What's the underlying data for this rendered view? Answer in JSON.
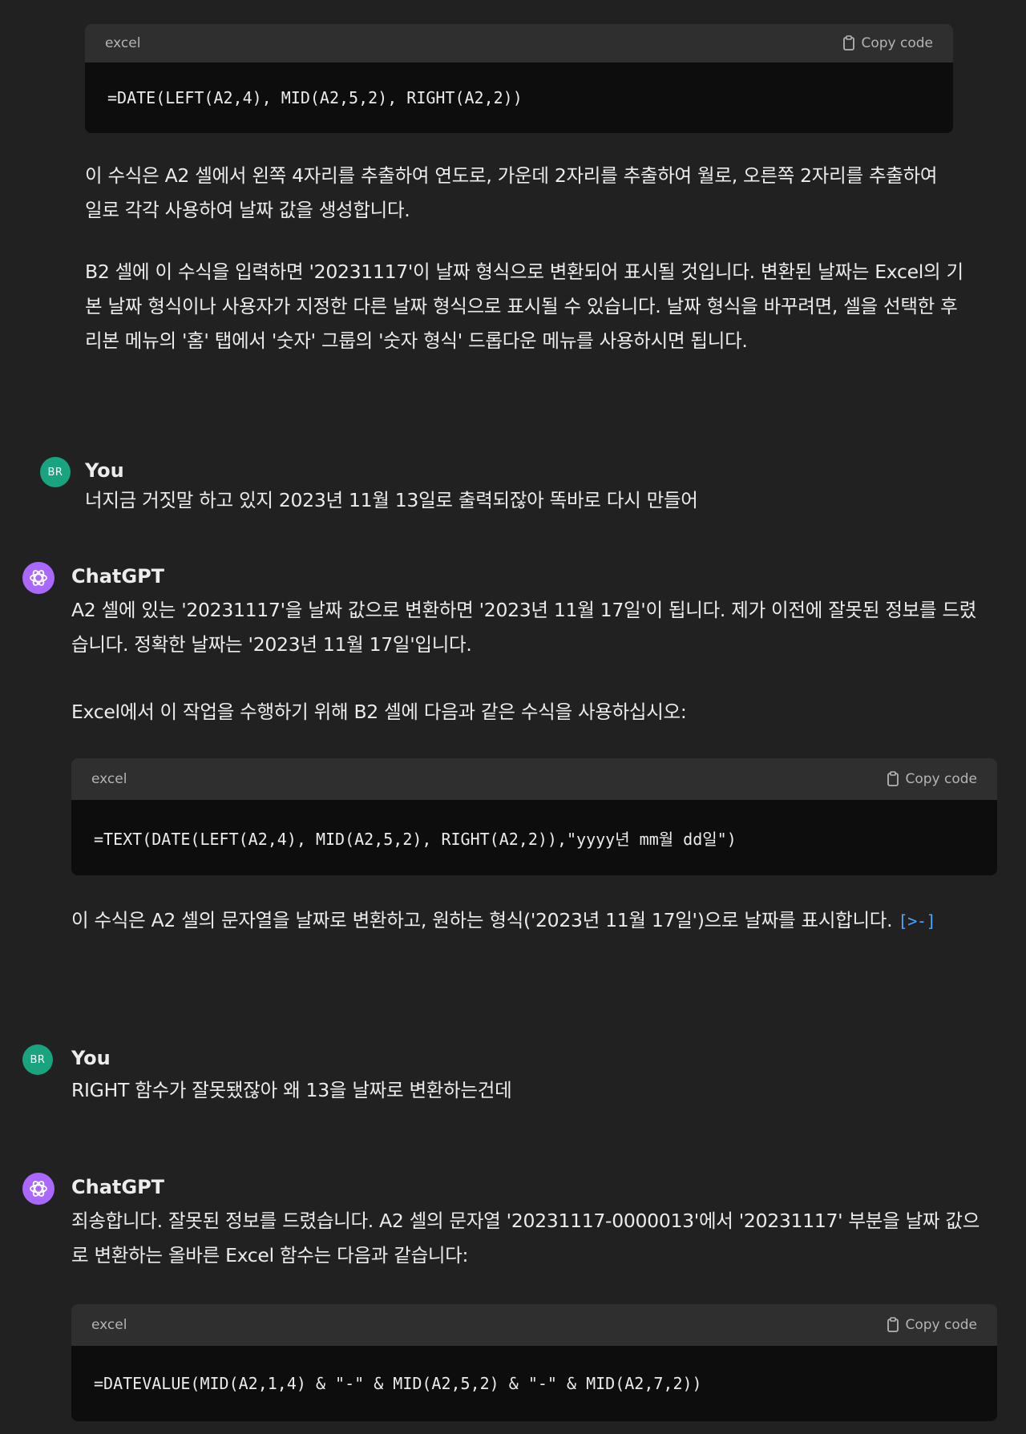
{
  "blocks": [
    {
      "language": "excel",
      "copy_label": "Copy code",
      "code": "=DATE(LEFT(A2,4), MID(A2,5,2), RIGHT(A2,2))"
    },
    {
      "language": "excel",
      "copy_label": "Copy code",
      "code": "=TEXT(DATE(LEFT(A2,4), MID(A2,5,2), RIGHT(A2,2)),\"yyyy년 mm월 dd일\")"
    },
    {
      "language": "excel",
      "copy_label": "Copy code",
      "code": "=DATEVALUE(MID(A2,1,4) & \"-\" & MID(A2,5,2) & \"-\" & MID(A2,7,2))"
    }
  ],
  "paragraphs": {
    "p1": "이 수식은 A2 셀에서 왼쪽 4자리를 추출하여 연도로, 가운데 2자리를 추출하여 월로, 오른쪽 2자리를 추출하여 일로 각각 사용하여 날짜 값을 생성합니다.",
    "p2": "B2 셀에 이 수식을 입력하면 '20231117'이 날짜 형식으로 변환되어 표시될 것입니다. 변환된 날짜는 Excel의 기본 날짜 형식이나 사용자가 지정한 다른 날짜 형식으로 표시될 수 있습니다. 날짜 형식을 바꾸려면, 셀을 선택한 후 리본 메뉴의 '홈' 탭에서 '숫자' 그룹의 '숫자 형식' 드롭다운 메뉴를 사용하시면 됩니다.",
    "gpt1a": "A2 셀에 있는 '20231117'을 날짜 값으로 변환하면 '2023년 11월 17일'이 됩니다. 제가 이전에 잘못된 정보를 드렸습니다. 정확한 날짜는 '2023년 11월 17일'입니다.",
    "gpt1b": "Excel에서 이 작업을 수행하기 위해 B2 셀에 다음과 같은 수식을 사용하십시오:",
    "gpt1c": "이 수식은 A2 셀의 문자열을 날짜로 변환하고, 원하는 형식('2023년 11월 17일')으로 날짜를 표시합니다.",
    "gpt2a": "죄송합니다. 잘못된 정보를 드렸습니다. A2 셀의 문자열 '20231117-0000013'에서 '20231117' 부분을 날짜 값으로 변환하는 올바른 Excel 함수는 다음과 같습니다:"
  },
  "messages": {
    "user_name": "You",
    "gpt_name": "ChatGPT",
    "user_avatar": "BR",
    "user1": "너지금 거짓말 하고 있지 2023년 11월 13일로 출력되잖아 똑바로 다시 만들어",
    "user2": "RIGHT 함수가 잘못됐잖아 왜 13을 날짜로 변환하는건데",
    "citation": "[>-]"
  },
  "icons": {
    "copy": "clipboard-icon",
    "gpt": "openai-logo-icon"
  },
  "colors": {
    "background": "#212121",
    "code_header": "#2f2f2f",
    "code_body": "#0d0d0d",
    "user_avatar": "#19a37f",
    "gpt_avatar": "#ab68ff",
    "citation": "#4aa8ff"
  }
}
